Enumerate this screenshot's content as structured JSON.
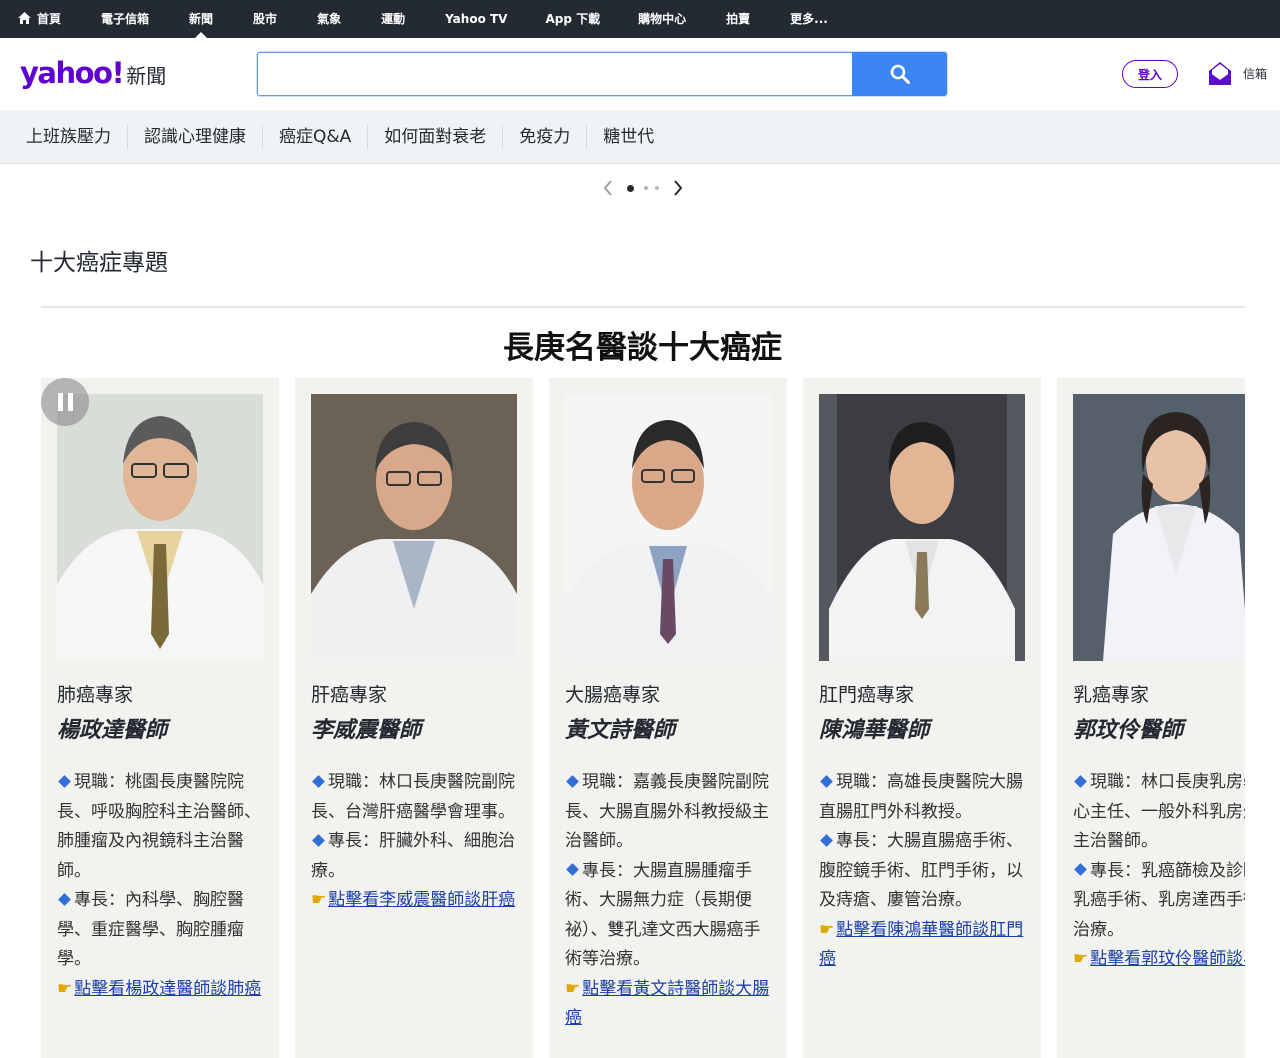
{
  "topnav": {
    "items": [
      "首頁",
      "電子信箱",
      "新聞",
      "股市",
      "氣象",
      "運動",
      "Yahoo TV",
      "App 下載",
      "購物中心",
      "拍賣",
      "更多..."
    ],
    "active": "新聞"
  },
  "header": {
    "logo_brand": "yahoo!",
    "logo_section": "新聞",
    "search_value": "",
    "login_label": "登入",
    "mail_label": "信箱"
  },
  "topics": [
    "上班族壓力",
    "認識心理健康",
    "癌症Q&A",
    "如何面對衰老",
    "免疫力",
    "糖世代"
  ],
  "pager": {
    "pages": 3,
    "current": 1
  },
  "section_title": "十大癌症專題",
  "banner_title": "長庚名醫談十大癌症",
  "cards": [
    {
      "role": "肺癌專家",
      "name": "楊政達醫師",
      "lines": [
        {
          "type": "bullet",
          "text": "現職：桃園長庚醫院院長、呼吸胸腔科主治醫師、肺腫瘤及內視鏡科主治醫師。"
        },
        {
          "type": "bullet",
          "text": "專長：內科學、胸腔醫學、重症醫學、胸腔腫瘤學。"
        },
        {
          "type": "link",
          "text": "點擊看楊政達醫師談肺癌"
        }
      ]
    },
    {
      "role": "肝癌專家",
      "name": "李威震醫師",
      "lines": [
        {
          "type": "bullet",
          "text": "現職：林口長庚醫院副院長、台灣肝癌醫學會理事。"
        },
        {
          "type": "bullet",
          "text": "專長：肝臟外科、細胞治療。"
        },
        {
          "type": "link",
          "text": "點擊看李威震醫師談肝癌"
        }
      ]
    },
    {
      "role": "大腸癌專家",
      "name": "黃文詩醫師",
      "lines": [
        {
          "type": "bullet",
          "text": "現職：嘉義長庚醫院副院長、大腸直腸外科教授級主治醫師。"
        },
        {
          "type": "bullet",
          "text": "專長：大腸直腸腫瘤手術、大腸無力症（長期便祕）、雙孔達文西大腸癌手術等治療。"
        },
        {
          "type": "link",
          "text": "點擊看黃文詩醫師談大腸癌"
        }
      ]
    },
    {
      "role": "肛門癌專家",
      "name": "陳鴻華醫師",
      "lines": [
        {
          "type": "bullet",
          "text": "現職：高雄長庚醫院大腸直腸肛門外科教授。"
        },
        {
          "type": "bullet",
          "text": "專長：大腸直腸癌手術、腹腔鏡手術、肛門手術，以及痔瘡、廔管治療。"
        },
        {
          "type": "link",
          "text": "點擊看陳鴻華醫師談肛門癌"
        }
      ]
    },
    {
      "role": "乳癌專家",
      "name": "郭玟伶醫師",
      "lines": [
        {
          "type": "bullet",
          "text": "現職：林口長庚乳房學中心主任、一般外科乳房外科主治醫師。"
        },
        {
          "type": "bullet",
          "text": "專長：乳癌篩檢及診斷、乳癌手術、乳房達西手術等治療。"
        },
        {
          "type": "link",
          "text": "點擊看郭玟伶醫師談乳癌"
        }
      ]
    }
  ],
  "colors": {
    "nav_bg": "#232a31",
    "brand_purple": "#6001d2",
    "search_blue": "#3b86f2",
    "card_bg": "#f2f2ef",
    "link": "#1a3fa8"
  }
}
